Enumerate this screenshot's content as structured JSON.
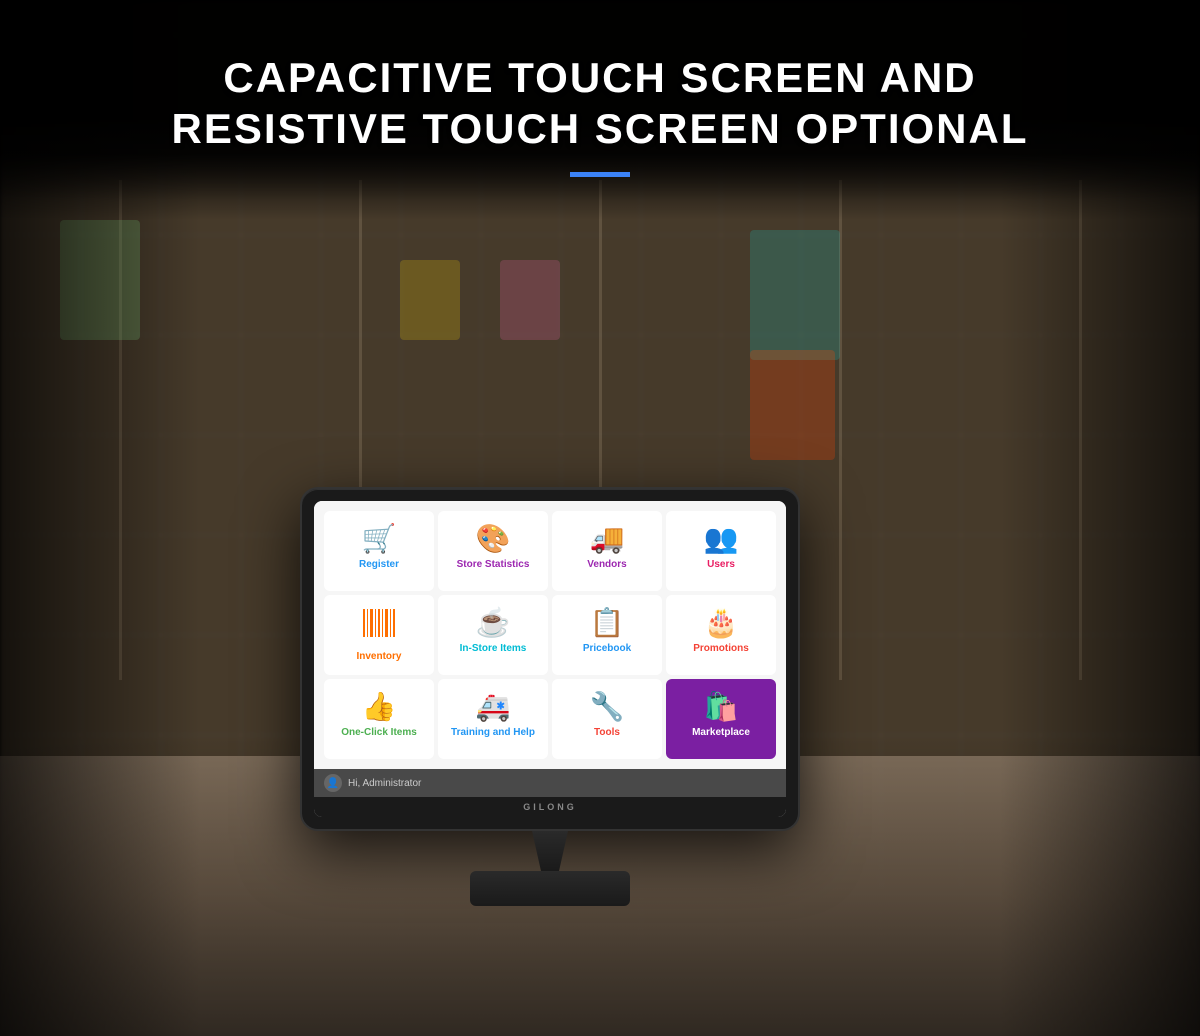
{
  "header": {
    "title_line1": "CAPACITIVE TOUCH SCREEN AND",
    "title_line2": "RESISTIVE TOUCH SCREEN OPTIONAL"
  },
  "brand": {
    "name": "GILONG"
  },
  "monitor": {
    "status_bar": {
      "greeting": "Hi, Administrator"
    },
    "app_grid": {
      "tiles": [
        {
          "id": "register",
          "label": "Register",
          "icon": "🛒",
          "color": "#2196F3",
          "css_class": "tile-register"
        },
        {
          "id": "store-statistics",
          "label": "Store Statistics",
          "icon": "🎨",
          "color": "#9C27B0",
          "css_class": "tile-store-stats"
        },
        {
          "id": "vendors",
          "label": "Vendors",
          "icon": "🚚",
          "color": "#9C27B0",
          "css_class": "tile-vendors"
        },
        {
          "id": "users",
          "label": "Users",
          "icon": "👥",
          "color": "#E91E63",
          "css_class": "tile-users"
        },
        {
          "id": "inventory",
          "label": "Inventory",
          "icon": "|||",
          "color": "#FF6F00",
          "css_class": "tile-inventory",
          "icon_type": "barcode"
        },
        {
          "id": "instore-items",
          "label": "In-Store Items",
          "icon": "☕",
          "color": "#00BCD4",
          "css_class": "tile-instore"
        },
        {
          "id": "pricebook",
          "label": "Pricebook",
          "icon": "📋",
          "color": "#2196F3",
          "css_class": "tile-pricebook"
        },
        {
          "id": "promotions",
          "label": "Promotions",
          "icon": "🎂",
          "color": "#F44336",
          "css_class": "tile-promotions"
        },
        {
          "id": "oneclick-items",
          "label": "One-Click Items",
          "icon": "👍",
          "color": "#4CAF50",
          "css_class": "tile-oneclick"
        },
        {
          "id": "training-help",
          "label": "Training and Help",
          "icon": "🚑",
          "color": "#2196F3",
          "css_class": "tile-training"
        },
        {
          "id": "tools",
          "label": "Tools",
          "icon": "🔧",
          "color": "#F44336",
          "css_class": "tile-tools"
        },
        {
          "id": "marketplace",
          "label": "Marketplace",
          "icon": "🛍️",
          "color": "#FFD700",
          "css_class": "tile-marketplace",
          "bg": "#7B1FA2"
        }
      ]
    }
  }
}
